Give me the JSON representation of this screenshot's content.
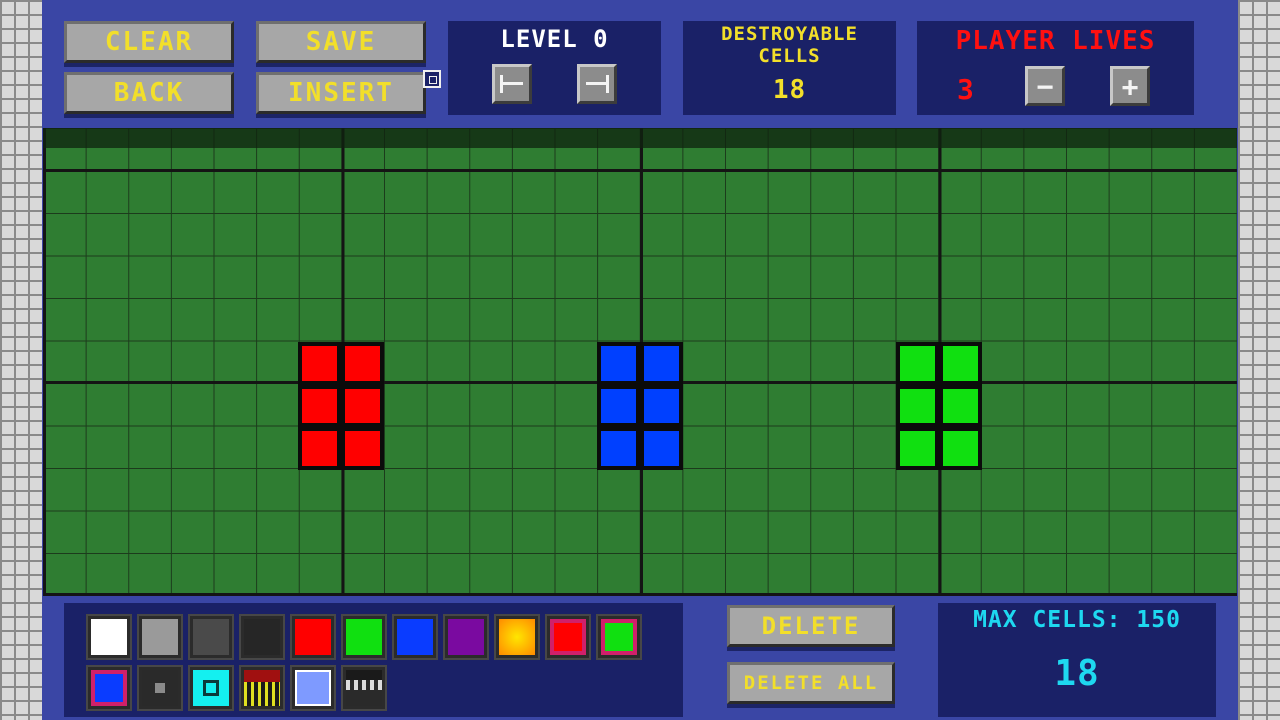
{
  "toolbar": {
    "clear": "CLEAR",
    "save": "SAVE",
    "back": "BACK",
    "insert": "INSERT"
  },
  "level": {
    "label": "LEVEL 0",
    "prev_icon": "arrow-left-bar-icon",
    "next_icon": "arrow-right-bar-icon"
  },
  "destroyable": {
    "line1": "DESTROYABLE",
    "line2": "CELLS",
    "count": "18"
  },
  "lives": {
    "label": "PLAYER LIVES",
    "value": "3",
    "minus": "−",
    "plus": "+"
  },
  "actions": {
    "delete": "DELETE",
    "delete_all": "DELETE ALL"
  },
  "max_cells": {
    "label": "MAX CELLS: 150",
    "count": "18"
  },
  "grid": {
    "columns": 28,
    "rows": 11,
    "groups": [
      {
        "name": "red-block-group",
        "color": "#ff0000"
      },
      {
        "name": "blue-block-group",
        "color": "#0040ff"
      },
      {
        "name": "green-block-group",
        "color": "#10e010"
      }
    ]
  },
  "palette": {
    "row1": [
      {
        "name": "white-swatch",
        "color": "#ffffff"
      },
      {
        "name": "gray-swatch",
        "color": "#9a9a9a"
      },
      {
        "name": "dark-gray-swatch",
        "color": "#4a4a4a"
      },
      {
        "name": "black-swatch",
        "color": "#262626"
      },
      {
        "name": "red-swatch",
        "color": "#ff0000"
      },
      {
        "name": "green-swatch",
        "color": "#10e010"
      },
      {
        "name": "blue-swatch",
        "color": "#0a3cff"
      },
      {
        "name": "purple-swatch",
        "color": "#7a0aa0"
      },
      {
        "name": "orange-swatch",
        "color": "#ffb000"
      },
      {
        "name": "red-pink-border-swatch",
        "color": "#ff0000"
      },
      {
        "name": "green-pink-border-swatch",
        "color": "#10e010"
      }
    ],
    "row2": [
      {
        "name": "blue-pink-border-swatch",
        "color": "#0a3cff"
      },
      {
        "name": "black-gray-core-swatch",
        "color": "#2a2a2a"
      },
      {
        "name": "cyan-swatch",
        "color": "#14f0f0"
      },
      {
        "name": "bars-swatch",
        "color": "#1a1a1a"
      },
      {
        "name": "light-blue-swatch",
        "color": "#7e9aff"
      },
      {
        "name": "film-strip-swatch",
        "color": "#2a2a2a"
      }
    ]
  }
}
